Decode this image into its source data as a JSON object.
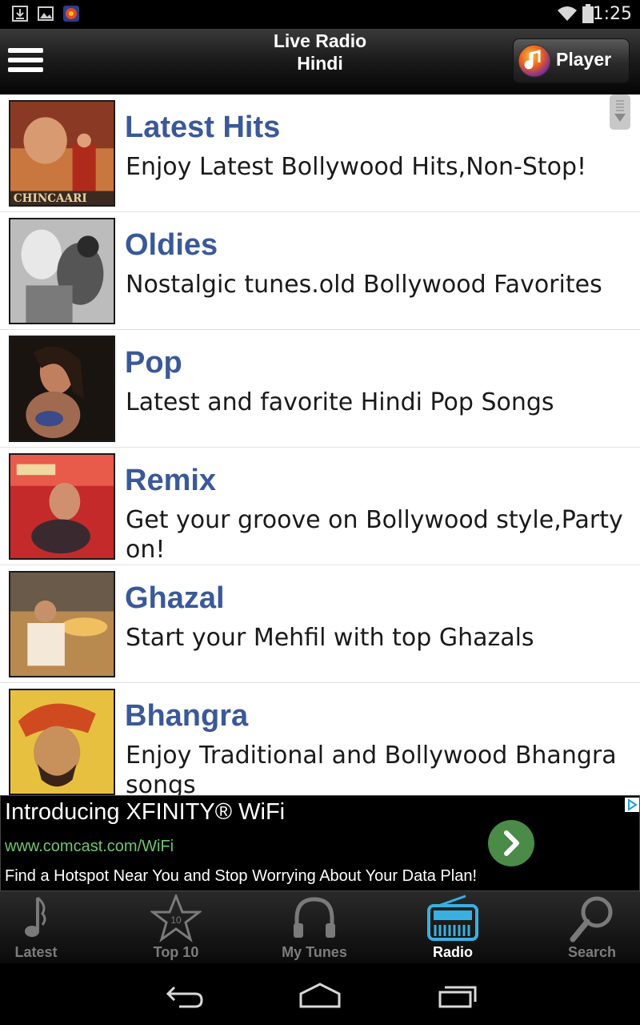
{
  "status_bar": {
    "time": "1:25"
  },
  "header": {
    "title": "Live Radio",
    "subtitle": "Hindi",
    "player_label": "Player"
  },
  "stations": [
    {
      "title": "Latest Hits",
      "description": "Enjoy Latest Bollywood Hits,Non-Stop!"
    },
    {
      "title": "Oldies",
      "description": "Nostalgic tunes.old Bollywood Favorites"
    },
    {
      "title": "Pop",
      "description": "Latest and favorite Hindi Pop Songs"
    },
    {
      "title": "Remix",
      "description": "Get your groove on Bollywood style,Party on!"
    },
    {
      "title": "Ghazal",
      "description": "Start your Mehfil with top Ghazals"
    },
    {
      "title": "Bhangra",
      "description": "Enjoy Traditional and Bollywood Bhangra songs"
    }
  ],
  "ad": {
    "title": "Introducing XFINITY® WiFi",
    "url": "www.comcast.com/WiFi",
    "description": "Find a Hotspot Near You and Stop Worrying About Your Data Plan!"
  },
  "tabs": [
    {
      "label": "Latest",
      "icon": "music-note-icon"
    },
    {
      "label": "Top 10",
      "icon": "star-icon"
    },
    {
      "label": "My Tunes",
      "icon": "headphones-icon"
    },
    {
      "label": "Radio",
      "icon": "radio-icon",
      "active": true
    },
    {
      "label": "Search",
      "icon": "search-icon"
    }
  ],
  "colors": {
    "accent_title": "#3b5998",
    "active_tab": "#3ab0e0",
    "ad_url": "#71c56e"
  }
}
